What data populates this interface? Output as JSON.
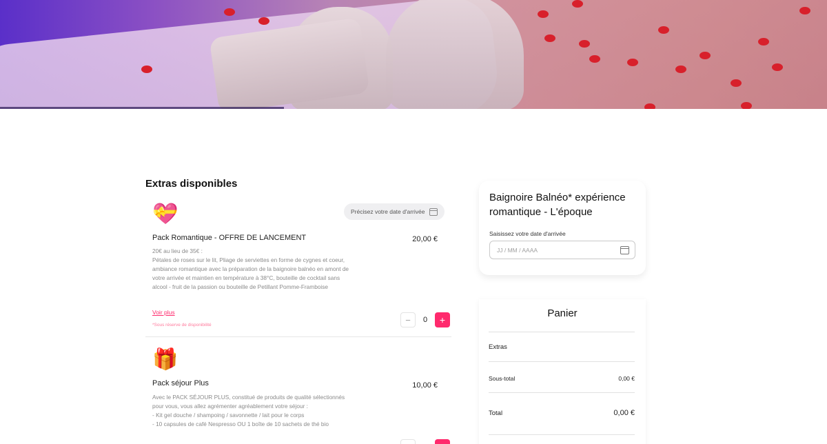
{
  "extras": {
    "section_title": "Extras disponibles",
    "date_pill": "Précisez votre date d'arrivée",
    "items": [
      {
        "emoji": "💝",
        "name": "Pack Romantique - OFFRE DE LANCEMENT",
        "price": "20,00 €",
        "description": "20€ au lieu de 35€ :\nPétales de roses sur le lit, Pliage de serviettes en forme de cygnes et coeur, ambiance romantique avec la préparation de la baignoire balnéo en amont de votre arrivée et maintien en température à 38°C, bouteille de cocktail sans alcool - fruit de la passion ou bouteille de Petillant Pomme-Framboise",
        "more_label": "Voir plus",
        "note": "*Sous réserve de disponibilité",
        "quantity": "0",
        "minus": "−",
        "plus": "+"
      },
      {
        "emoji": "🎁",
        "name": "Pack séjour Plus",
        "price": "10,00 €",
        "description": "Avec le PACK SÉJOUR PLUS, constitué de produits de qualité sélectionnés pour vous, vous allez agrémenter agréablement votre séjour :\n- Kit gel douche / shampoing / savonnette / lait pour le corps\n- 10 capsules de café Nespresso OU 1 boîte de 10 sachets de thé bio",
        "minus": "−",
        "plus": "+"
      }
    ]
  },
  "booking": {
    "title": "Baignoire Balnéo* expérience romantique - L'époque",
    "date_label": "Saisissez votre date d'arrivée",
    "date_placeholder": "JJ / MM / AAAA"
  },
  "cart": {
    "title": "Panier",
    "extras_label": "Extras",
    "subtotal_label": "Sous-total",
    "subtotal_value": "0,00 €",
    "total_label": "Total",
    "total_value": "0,00 €"
  },
  "colors": {
    "accent": "#ff2a6d"
  }
}
